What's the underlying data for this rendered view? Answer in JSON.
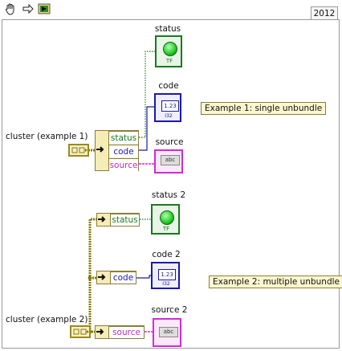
{
  "toolbar": {
    "tools": [
      {
        "name": "operate-hand-icon"
      },
      {
        "name": "position-arrow-icon"
      },
      {
        "name": "run-vi-icon"
      }
    ],
    "year": "2012"
  },
  "example1": {
    "cluster_label": "cluster (example 1)",
    "unbundle_fields": [
      "status",
      "code",
      "source"
    ],
    "indicators": {
      "status": "status",
      "code": "code",
      "source": "source"
    },
    "free_label": "Example 1: single unbundle"
  },
  "example2": {
    "cluster_label": "cluster (example 2)",
    "unbundle_fields": [
      "status",
      "code",
      "source"
    ],
    "indicators": {
      "status": "status 2",
      "code": "code 2",
      "source": "source 2"
    },
    "free_label": "Example 2: multiple unbundle"
  },
  "terminals": {
    "numeric_text": "1.23",
    "numeric_type": "I32",
    "string_text": "abc",
    "bool_type": "TF"
  },
  "colors": {
    "bool_wire": "#1a7a1a",
    "int_wire": "#1a1aa8",
    "string_wire": "#d42ad4",
    "cluster_wire": "#8a7800",
    "led_on": "#2ad12a"
  }
}
